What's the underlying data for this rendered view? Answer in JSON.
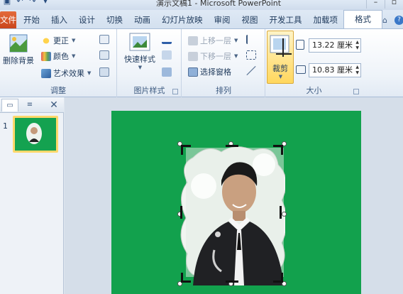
{
  "title_bar": {
    "text": "演示文稿1 - Microsoft PowerPoint",
    "quick_access": [
      "save-icon",
      "undo-icon",
      "redo-icon",
      "customize-icon"
    ],
    "window_buttons": [
      "minimize-icon",
      "restore-icon"
    ]
  },
  "tabs": {
    "file": "文件",
    "items": [
      "开始",
      "插入",
      "设计",
      "切换",
      "动画",
      "幻灯片放映",
      "审阅",
      "视图",
      "开发工具",
      "加载项"
    ],
    "active": "格式"
  },
  "ribbon": {
    "adjust": {
      "label": "调整",
      "remove_bg": "删除背景",
      "corrections": "更正",
      "color": "颜色",
      "artistic": "艺术效果"
    },
    "picture_styles": {
      "label": "图片样式",
      "quick_styles": "快速样式"
    },
    "arrange": {
      "label": "排列",
      "bring_forward": "上移一层",
      "send_backward": "下移一层",
      "selection_pane": "选择窗格"
    },
    "size": {
      "label": "大小",
      "crop": "裁剪",
      "height": "13.22 厘米",
      "width": "10.83 厘米"
    }
  },
  "slides_panel": {
    "slide_number": "1"
  }
}
